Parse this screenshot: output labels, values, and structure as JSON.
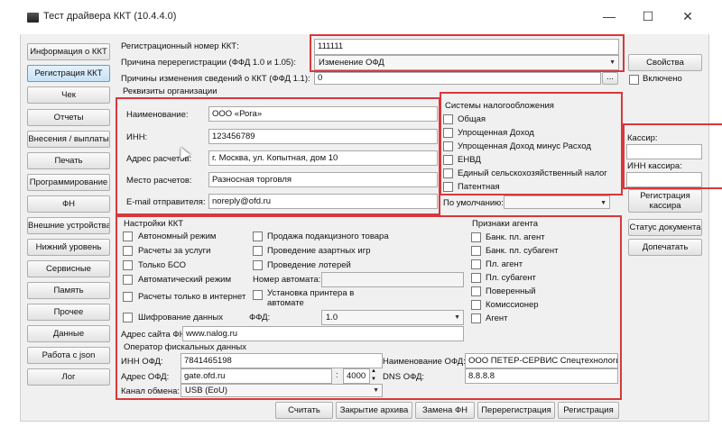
{
  "window": {
    "title": "Тест драйвера ККТ (10.4.4.0)",
    "minimize": "—",
    "maximize": "☐",
    "close": "✕"
  },
  "sidebar": {
    "items": [
      {
        "label": "Информация о ККТ"
      },
      {
        "label": "Регистрация ККТ"
      },
      {
        "label": "Чек"
      },
      {
        "label": "Отчеты"
      },
      {
        "label": "Внесения / выплаты"
      },
      {
        "label": "Печать"
      },
      {
        "label": "Программирование"
      },
      {
        "label": "ФН"
      },
      {
        "label": "Внешние устройства"
      },
      {
        "label": "Нижний уровень"
      },
      {
        "label": "Сервисные"
      },
      {
        "label": "Память"
      },
      {
        "label": "Прочее"
      },
      {
        "label": "Данные"
      },
      {
        "label": "Работа с json"
      },
      {
        "label": "Лог"
      }
    ]
  },
  "reg": {
    "reg_number_label": "Регистрационный номер ККТ:",
    "reg_number_value": "111111",
    "reason_label": "Причина перерегистрации (ФФД 1.0 и 1.05):",
    "reason_value": "Изменение ОФД",
    "changes_label": "Причины изменения сведений о ККТ (ФФД 1.1):",
    "changes_value": "0",
    "more_btn": "...",
    "properties_btn": "Свойства",
    "enabled_label": "Включено"
  },
  "org": {
    "group_title": "Реквизиты организации",
    "name_label": "Наименование:",
    "name_value": "ООО «Рога»",
    "inn_label": "ИНН:",
    "inn_value": "123456789",
    "address_label": "Адрес расчетов:",
    "address_value": "г. Москва, ул. Копытная, дом 10",
    "place_label": "Место расчетов:",
    "place_value": "Разносная торговля",
    "email_label": "E-mail отправителя:",
    "email_value": "noreply@ofd.ru"
  },
  "tax": {
    "title": "Системы налогообложения",
    "options": [
      "Общая",
      "Упрощенная Доход",
      "Упрощенная Доход минус Расход",
      "ЕНВД",
      "Единый сельскохозяйственный налог",
      "Патентная"
    ],
    "default_label": "По умолчанию:",
    "default_value": ""
  },
  "cashier": {
    "cashier_label": "Кассир:",
    "cashier_inn_label": "ИНН кассира:",
    "register_btn": "Регистрация кассира",
    "doc_status_btn": "Статус документа",
    "reprint_btn": "Допечатать"
  },
  "kkt": {
    "title": "Настройки ККТ",
    "col1": [
      "Автономный режим",
      "Расчеты за услуги",
      "Только БСО",
      "Автоматический режим",
      "Расчеты только в интернет",
      "Шифрование данных"
    ],
    "col2": [
      "Продажа подакцизного товара",
      "Проведение азартных игр",
      "Проведение лотерей"
    ],
    "machine_number_label": "Номер автомата:",
    "printer_label": "Установка принтера в автомате",
    "ffd_label": "ФФД:",
    "ffd_value": "1.0",
    "fns_site_label": "Адрес сайта ФНС:",
    "fns_site_value": "www.nalog.ru"
  },
  "agent": {
    "title": "Признаки агента",
    "items": [
      "Банк. пл. агент",
      "Банк. пл. субагент",
      "Пл. агент",
      "Пл. субагент",
      "Поверенный",
      "Комиссионер",
      "Агент"
    ]
  },
  "ofd": {
    "title": "Оператор фискальных данных",
    "inn_label": "ИНН ОФД:",
    "inn_value": "7841465198",
    "name_label": "Наименование ОФД:",
    "name_value": "ООО ПЕТЕР-СЕРВИС Спецтехнологии",
    "address_label": "Адрес ОФД:",
    "address_value": "gate.ofd.ru",
    "port_value": "4000",
    "dns_label": "DNS ОФД:",
    "dns_value": "8.8.8.8",
    "channel_label": "Канал обмена:",
    "channel_value": "USB (EoU)"
  },
  "footer": {
    "read_btn": "Считать",
    "close_archive_btn": "Закрытие архива",
    "replace_fn_btn": "Замена ФН",
    "reregister_btn": "Перерегистрация",
    "register_btn": "Регистрация"
  },
  "colors": {
    "highlight": "#d8383c",
    "active_tab": "#c7e2f7"
  }
}
